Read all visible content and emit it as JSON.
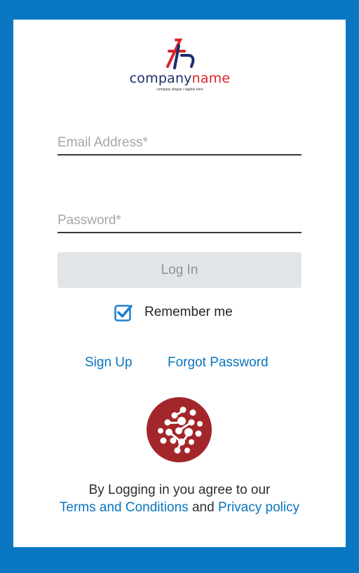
{
  "logo": {
    "name_part1": "company",
    "name_part2": "name",
    "slogan": "company slogan / tagline here"
  },
  "form": {
    "email_placeholder": "Email Address*",
    "email_value": "",
    "password_placeholder": "Password*",
    "password_value": "",
    "login_label": "Log In",
    "remember_label": "Remember me",
    "remember_checked": true
  },
  "links": {
    "signup": "Sign Up",
    "forgot": "Forgot Password"
  },
  "agreement": {
    "prefix": "By Logging in you agree to our",
    "terms": "Terms and Conditions",
    "and": "and",
    "privacy": "Privacy policy"
  },
  "colors": {
    "background": "#0a77c2",
    "card": "#ffffff",
    "link": "#0a74bd",
    "button_disabled": "#e2e5e8",
    "checkbox": "#1f7fd0",
    "badge": "#a3262a",
    "logo_navy": "#1d2c6b",
    "logo_red": "#d8262d"
  },
  "icons": {
    "logo_mark": "company-logo-mark",
    "checkbox": "checkbox-checked-icon",
    "brand_badge": "network-dots-badge"
  }
}
